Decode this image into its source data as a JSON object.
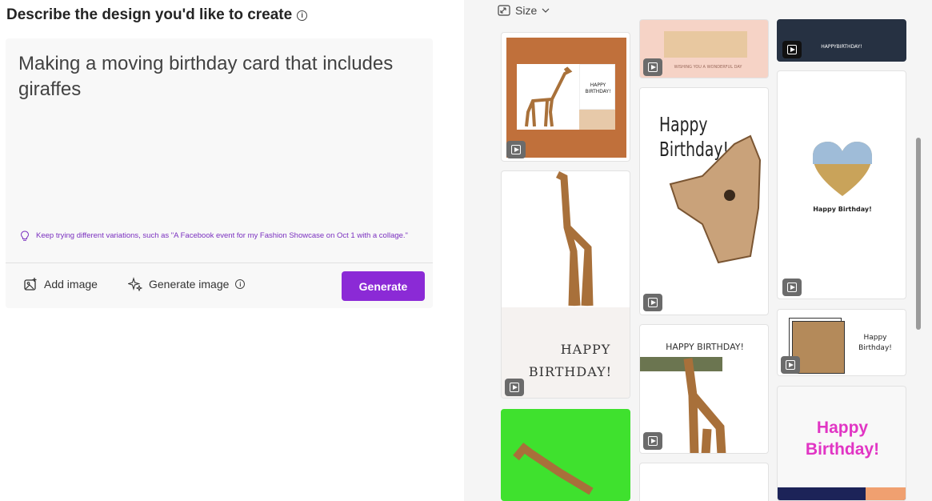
{
  "left": {
    "heading": "Describe the design you'd like to create",
    "prompt": "Making a moving birthday card that includes giraffes",
    "tip": "Keep trying different variations, such as \"A Facebook event for my Fashion Showcase on Oct 1 with a collage.\"",
    "add_image": "Add image",
    "generate_image": "Generate image",
    "generate": "Generate"
  },
  "right": {
    "size_filter": "Size",
    "cards": {
      "c1_title": "HAPPY BIRTHDAY!",
      "c2_text": "WISHING YOU A WONDERFUL DAY",
      "c3_text": "HAPPYBIRTHDAY!",
      "c5_line1": "Happy",
      "c5_line2": "Birthday!",
      "c6_text": "Happy Birthday!",
      "c7_line1": "HAPPY",
      "c7_line2": "BIRTHDAY!",
      "c8_text": "HAPPY BIRTHDAY!",
      "c9_line1": "Happy",
      "c9_line2": "Birthday!",
      "c10_line1": "Happy",
      "c10_line2": "Birthday!"
    }
  }
}
